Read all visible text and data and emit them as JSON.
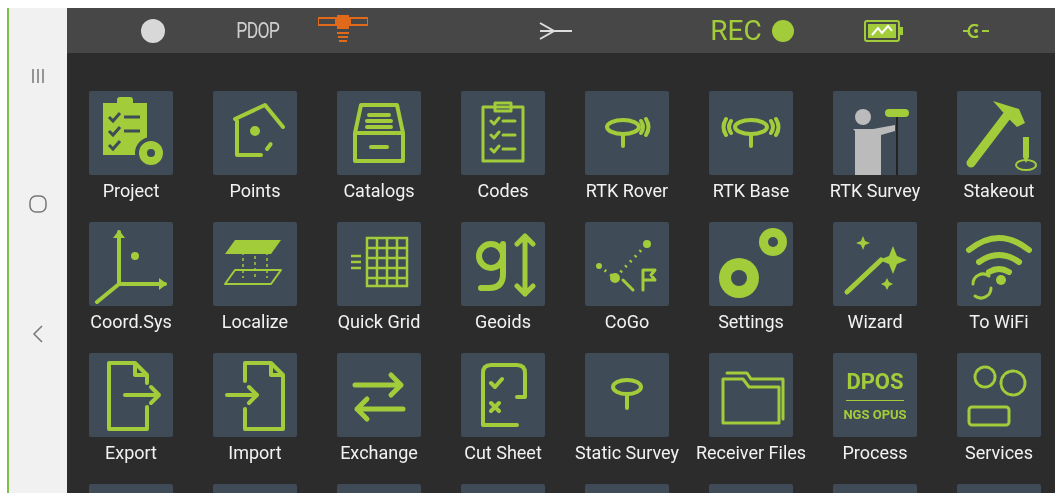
{
  "status_bar": {
    "pdop": "PDOP",
    "rec": "REC"
  },
  "tiles": [
    {
      "label": "Project"
    },
    {
      "label": "Points"
    },
    {
      "label": "Catalogs"
    },
    {
      "label": "Codes"
    },
    {
      "label": "RTK Rover"
    },
    {
      "label": "RTK Base"
    },
    {
      "label": "RTK Survey"
    },
    {
      "label": "Stakeout"
    },
    {
      "label": "Coord.Sys"
    },
    {
      "label": "Localize"
    },
    {
      "label": "Quick Grid"
    },
    {
      "label": "Geoids"
    },
    {
      "label": "CoGo"
    },
    {
      "label": "Settings"
    },
    {
      "label": "Wizard"
    },
    {
      "label": "To WiFi"
    },
    {
      "label": "Export"
    },
    {
      "label": "Import"
    },
    {
      "label": "Exchange"
    },
    {
      "label": "Cut Sheet"
    },
    {
      "label": "Static Survey"
    },
    {
      "label": "Receiver Files"
    },
    {
      "label": "Process",
      "icon_texts": [
        "DPOS",
        "NGS OPUS"
      ]
    },
    {
      "label": "Services"
    }
  ]
}
